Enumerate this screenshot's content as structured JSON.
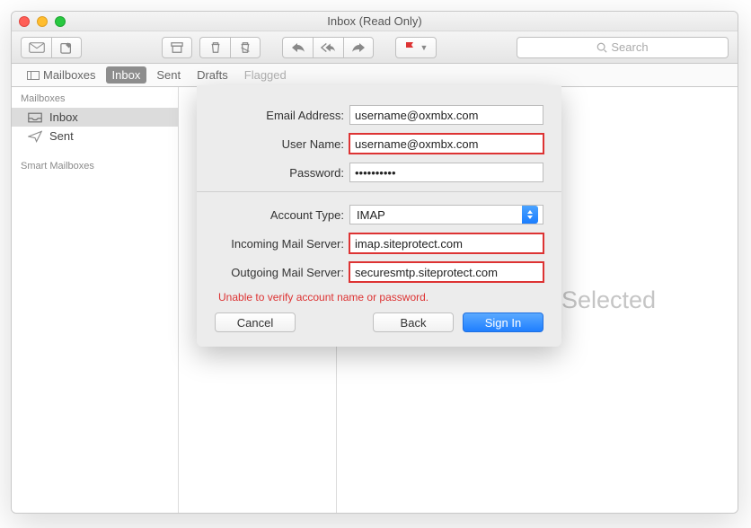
{
  "window": {
    "title": "Inbox (Read Only)"
  },
  "toolbar": {
    "flag_color": "#d33",
    "search_placeholder": "Search"
  },
  "favorites": {
    "mailboxes": "Mailboxes",
    "inbox": "Inbox",
    "sent": "Sent",
    "drafts": "Drafts",
    "flagged": "Flagged"
  },
  "sidebar": {
    "header": "Mailboxes",
    "items": [
      {
        "label": "Inbox"
      },
      {
        "label": "Sent"
      }
    ],
    "smart_header": "Smart Mailboxes"
  },
  "preview": {
    "empty_text": "No Message Selected"
  },
  "dialog": {
    "labels": {
      "email": "Email Address:",
      "username": "User Name:",
      "password": "Password:",
      "account_type": "Account Type:",
      "incoming": "Incoming Mail Server:",
      "outgoing": "Outgoing Mail Server:"
    },
    "values": {
      "email": "username@oxmbx.com",
      "username": "username@oxmbx.com",
      "password": "••••••••••",
      "account_type": "IMAP",
      "incoming": "imap.siteprotect.com",
      "outgoing": "securesmtp.siteprotect.com"
    },
    "error": "Unable to verify account name or password.",
    "buttons": {
      "cancel": "Cancel",
      "back": "Back",
      "signin": "Sign In"
    }
  }
}
